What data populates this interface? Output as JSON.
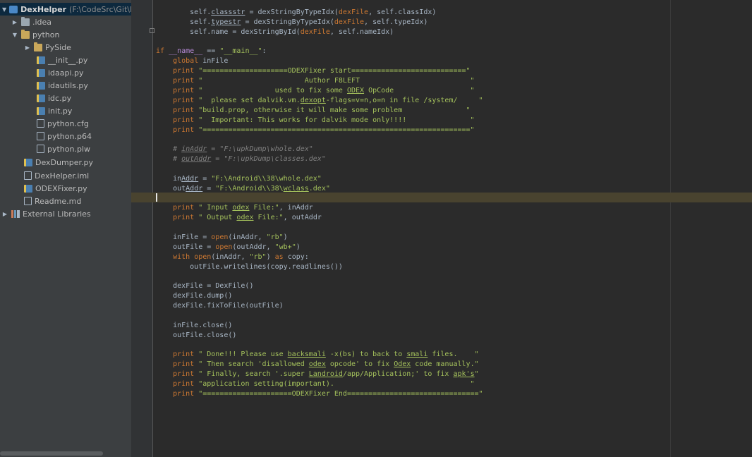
{
  "project_tree": {
    "root": {
      "name": "DexHelper",
      "path": "(F:\\CodeSrc\\Git\\De"
    },
    "items": [
      {
        "label": ".idea",
        "icon": "folder-icon"
      },
      {
        "label": "python",
        "icon": "folder-icon"
      },
      {
        "label": "PySide",
        "icon": "folder-icon"
      },
      {
        "label": "__init__.py",
        "icon": "python-file-icon"
      },
      {
        "label": "idaapi.py",
        "icon": "python-file-icon"
      },
      {
        "label": "idautils.py",
        "icon": "python-file-icon"
      },
      {
        "label": "idc.py",
        "icon": "python-file-icon"
      },
      {
        "label": "init.py",
        "icon": "python-file-icon"
      },
      {
        "label": "python.cfg",
        "icon": "config-file-icon"
      },
      {
        "label": "python.p64",
        "icon": "file-icon"
      },
      {
        "label": "python.plw",
        "icon": "file-icon"
      },
      {
        "label": "DexDumper.py",
        "icon": "python-file-icon"
      },
      {
        "label": "DexHelper.iml",
        "icon": "file-icon"
      },
      {
        "label": "ODEXFixer.py",
        "icon": "python-file-icon"
      },
      {
        "label": "Readme.md",
        "icon": "file-icon"
      },
      {
        "label": "External Libraries",
        "icon": "library-icon"
      }
    ]
  },
  "code": {
    "l1": {
      "a": "        self.",
      "b": "classstr",
      "c": " = dexStringByTypeIdx(",
      "d": "dexFile",
      "e": ", self.classIdx)"
    },
    "l2": {
      "a": "        self.",
      "b": "typestr",
      "c": " = dexStringByTypeIdx(",
      "d": "dexFile",
      "e": ", self.typeIdx)"
    },
    "l3": {
      "a": "        self.name = dexStringById(",
      "b": "dexFile",
      "c": ", self.nameIdx)"
    },
    "l4": {
      "a": "if ",
      "b": "__name__",
      "c": " == ",
      "d": "\"__main__\"",
      "e": ":"
    },
    "l5": {
      "a": "    ",
      "b": "global",
      "c": " inFile"
    },
    "l6": {
      "a": "    ",
      "b": "print",
      "c": " \"====================ODEXFixer start===========================\""
    },
    "l7": {
      "a": "    ",
      "b": "print",
      "c": " \"                        Author F8LEFT                          \""
    },
    "l8": {
      "a": "    ",
      "b": "print",
      "c": " \"                 used to fix some ",
      "d": "ODEX",
      "e": " OpCode                  \""
    },
    "l9": {
      "a": "    ",
      "b": "print",
      "c": " \"  please set dalvik.vm.",
      "d": "dexopt",
      "e": "-flags=v=n,o=n in file /system/     \""
    },
    "l10": {
      "a": "    ",
      "b": "print",
      "c": " \"build.prop, otherwise it will make some problem               \""
    },
    "l11": {
      "a": "    ",
      "b": "print",
      "c": " \"  Important: This works for dalvik mode only!!!!               \""
    },
    "l12": {
      "a": "    ",
      "b": "print",
      "c": " \"===============================================================\""
    },
    "l13": {
      "a": "    # ",
      "b": "inAddr",
      "c": " = \"F:\\upkDump\\whole.dex\""
    },
    "l14": {
      "a": "    # ",
      "b": "outAddr",
      "c": " = \"F:\\upkDump\\classes.dex\""
    },
    "l15": {
      "a": "    in",
      "b": "Addr",
      "c": " = ",
      "d": "\"F:\\Android\\\\38\\whole.dex\""
    },
    "l16": {
      "a": "    out",
      "b": "Addr",
      "c": " = ",
      "d": "\"F:\\Android\\\\38\\",
      "e": "wclass",
      "f": ".dex\""
    },
    "l17": {
      "a": "    ",
      "b": "print",
      "c": " \" Input ",
      "d": "odex",
      "e": " File:\"",
      "f": ", inAddr"
    },
    "l18": {
      "a": "    ",
      "b": "print",
      "c": " \" Output ",
      "d": "odex",
      "e": " File:\"",
      "f": ", outAddr"
    },
    "l19": {
      "a": "    inFile = ",
      "b": "open",
      "c": "(inAddr, ",
      "d": "\"rb\"",
      "e": ")"
    },
    "l20": {
      "a": "    outFile = ",
      "b": "open",
      "c": "(outAddr, ",
      "d": "\"wb+\"",
      "e": ")"
    },
    "l21": {
      "a": "    ",
      "b": "with",
      "c": " ",
      "d": "open",
      "e": "(inAddr, ",
      "f": "\"rb\"",
      "g": ") ",
      "h": "as",
      "i": " copy:"
    },
    "l22": {
      "a": "        outFile.writelines(copy.readlines())"
    },
    "l23": {
      "a": "    dexFile = DexFile()"
    },
    "l24": {
      "a": "    dexFile.dump()"
    },
    "l25": {
      "a": "    dexFile.fixToFile(outFile)"
    },
    "l26": {
      "a": "    inFile.close()"
    },
    "l27": {
      "a": "    outFile.close()"
    },
    "l28": {
      "a": "    ",
      "b": "print",
      "c": " \" Done!!! Please use ",
      "d": "backsmali",
      "e": " -x(bs) to back to ",
      "f": "smali",
      "g": " files.    \""
    },
    "l29": {
      "a": "    ",
      "b": "print",
      "c": " \" Then search 'disallowed ",
      "d": "odex",
      "e": " opcode' to fix ",
      "f": "Odex",
      "g": " code manually.\""
    },
    "l30": {
      "a": "    ",
      "b": "print",
      "c": " \" Finally, search '.super ",
      "d": "Landroid",
      "e": "/app/Application;' to fix ",
      "f": "apk's",
      "g": "\""
    },
    "l31": {
      "a": "    ",
      "b": "print",
      "c": " \"application setting(important).                                \""
    },
    "l32": {
      "a": "    ",
      "b": "print",
      "c": " \"=====================ODEXFixer End===============================\""
    }
  }
}
